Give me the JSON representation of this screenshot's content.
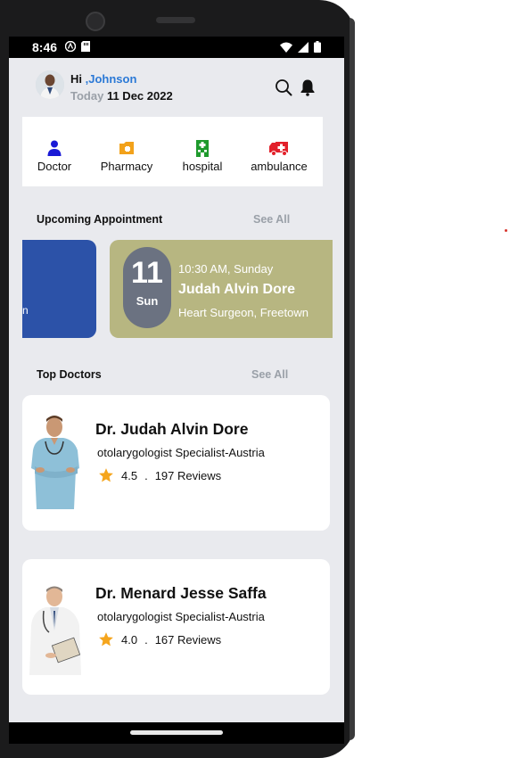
{
  "status": {
    "time": "8:46"
  },
  "header": {
    "greeting": "Hi ",
    "user_name": ",Johnson",
    "today_label": "Today",
    "date": "11 Dec 2022"
  },
  "categories": [
    {
      "label": "Doctor",
      "icon": "person-icon",
      "color": "#1a1ad6"
    },
    {
      "label": "Pharmacy",
      "icon": "pharmacy-icon",
      "color": "#f2a21b"
    },
    {
      "label": "hospital",
      "icon": "hospital-icon",
      "color": "#1e9a2c"
    },
    {
      "label": "ambulance",
      "icon": "ambulance-icon",
      "color": "#e2202a"
    }
  ],
  "appointments": {
    "title": "Upcoming Appointment",
    "see_all": "See All",
    "prev_card_clip": "n",
    "card": {
      "day": "11",
      "weekday": "Sun",
      "time": "10:30 AM, Sunday",
      "doctor": "Judah Alvin Dore",
      "specialty": "Heart Surgeon, Freetown"
    }
  },
  "top_doctors": {
    "title": "Top Doctors",
    "see_all": "See All",
    "items": [
      {
        "name": "Dr. Judah Alvin Dore",
        "specialty": "otolarygologist Specialist-Austria",
        "rating": "4.5",
        "separator": ".",
        "reviews": "197 Reviews"
      },
      {
        "name": "Dr. Menard Jesse Saffa",
        "specialty": "otolarygologist Specialist-Austria",
        "rating": "4.0",
        "separator": ".",
        "reviews": "167 Reviews"
      }
    ]
  },
  "colors": {
    "accent": "#2b79d6",
    "appointment_card": "#b7b681",
    "appointment_prev_card": "#2c52a8",
    "muted": "#9aa0a8",
    "star": "#f5a51c"
  }
}
